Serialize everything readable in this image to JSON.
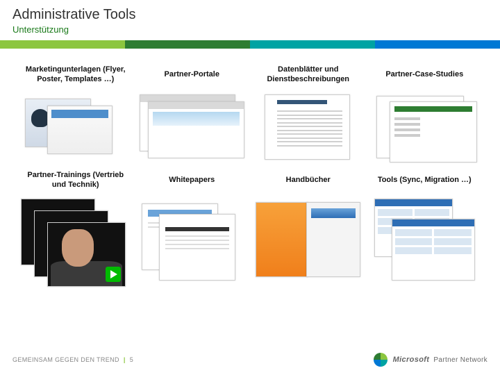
{
  "header": {
    "title": "Administrative Tools",
    "subtitle": "Unterstützung"
  },
  "grid": {
    "row1": [
      "Marketingunterlagen (Flyer, Poster, Templates …)",
      "Partner-Portale",
      "Datenblätter und Dienstbeschreibungen",
      "Partner-Case-Studies"
    ],
    "row2": [
      "Partner-Trainings (Vertrieb und Technik)",
      "Whitepapers",
      "Handbücher",
      "Tools (Sync, Migration …)"
    ]
  },
  "footer": {
    "tagline": "GEMEINSAM GEGEN DEN TREND",
    "page": "5",
    "brand_a": "Microsoft",
    "brand_b": "Partner Network"
  }
}
